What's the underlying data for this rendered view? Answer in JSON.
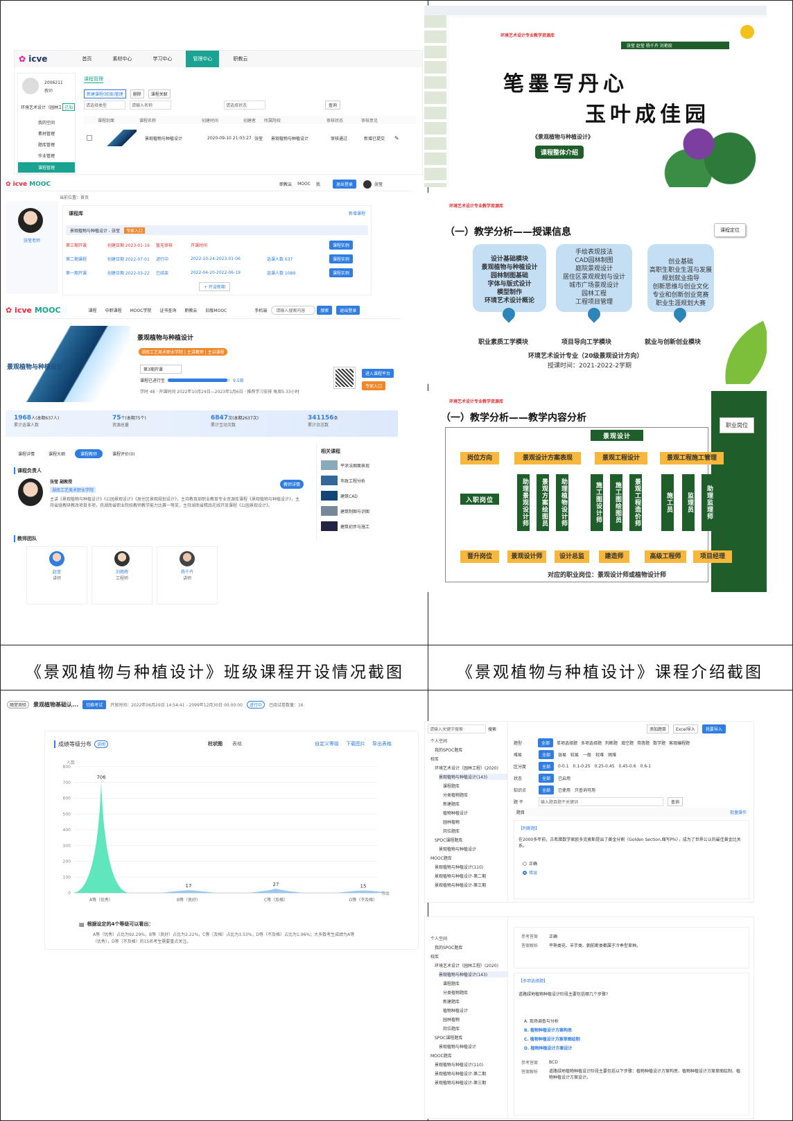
{
  "captions": {
    "left": "《景观植物与种植设计》班级课程开设情况截图",
    "right": "《景观植物与种植设计》课程介绍截图"
  },
  "icve": {
    "logo": "icve",
    "nav": [
      "首页",
      "素材中心",
      "学习中心",
      "管理中心",
      "职教云"
    ],
    "user_id": "2006211",
    "user_role": "教师",
    "school": "环境艺术设计（园林工程）",
    "school_tag": "已加",
    "side": [
      "我的空间",
      "素材管理",
      "题库管理",
      "作业管理",
      "课程管理"
    ],
    "tab": "课程管理",
    "btns": [
      "新建课程(班级)管理",
      "删除",
      "课程关联"
    ],
    "filters": [
      "请选择类型",
      "请输入名称",
      "请选择状态",
      "查询"
    ],
    "cols": [
      "课程封面",
      "课程名称",
      "创建时间",
      "创建者",
      "所属院校",
      "审核状态",
      "审核意见"
    ],
    "row": {
      "name": "景观植物与种植设计",
      "date": "2020-09-10 21:03:27",
      "owner": "张莹",
      "school": "景观植物与种植设计",
      "status": "审核通过",
      "note": "新增已提交"
    }
  },
  "mooc1": {
    "nav": [
      "职教云",
      "MOOC",
      "我"
    ],
    "btn": "退出登录",
    "user": "张莹",
    "crumb": "当前位置：首页",
    "teacher": "张莹老师",
    "lib": "课程库",
    "new": "新增课程",
    "course": "景观植物与种植设计 - 张莹",
    "tag": "专家入口",
    "rows": [
      {
        "t": "第三期开课",
        "d": "创建日期 2023-01-19",
        "s": "暂无审核",
        "p": "开课时间",
        "r": "",
        "a": "课程实例"
      },
      {
        "t": "第二期课程",
        "d": "创建日期 2022-07-01",
        "s": "进行中",
        "p": "2022-10-24-2023-01-06",
        "r": "选课人数 637",
        "a": "课程实例"
      },
      {
        "t": "第一期开课",
        "d": "创建日期 2022-03-22",
        "s": "已结束",
        "p": "2022-04-20-2022-06-19",
        "r": "选课人数 1089",
        "a": "课程实例"
      }
    ],
    "more": "+ 开设新期"
  },
  "mooc2": {
    "nav": [
      "课程",
      "中职课程",
      "MOOC学院",
      "证书查询",
      "职教云",
      "旧版MOOC"
    ],
    "phone": "手机端",
    "search_ph": "请输入搜索内容",
    "search": "搜索",
    "login": "退出登录",
    "title": "景观植物与种植设计",
    "cover": "景观植物与种植设计",
    "badge": "湖南工艺美术职业学院 | 主讲教师 | 主讲课程",
    "term": "第3期开课",
    "progress_label": "课程已进行至",
    "progress": "9.5周",
    "progress_pct": 0.95,
    "meta": "学时 48 · 开课时间 2022年10月24日—2023年1月6日 · 推荐学习安排 每周5.33小时",
    "enter": "进入课程平台",
    "expert": "专家入口",
    "stats": [
      {
        "v": "1968",
        "u": "人",
        "s": "(本期637人)",
        "l": "累计选课人数"
      },
      {
        "v": "75",
        "u": "个",
        "s": "(本期75个)",
        "l": "资源总量"
      },
      {
        "v": "6847",
        "u": "次",
        "s": "(本期2637次)",
        "l": "累计互动次数"
      },
      {
        "v": "341156",
        "u": "条",
        "s": "",
        "l": "累计日志数"
      }
    ],
    "tabs": [
      "课程详情",
      "课程大纲",
      "课程教师",
      "课程评价(0)"
    ],
    "lead": "课程负责人",
    "lead_name": "张莹 副教授",
    "lead_sub": "湖南工艺美术职业学院",
    "lead_btn": "教师详情",
    "lead_text": "主讲《景观植物与种植设计》《公园景观设计》《居住区景观规划设计》，主持教育部职业教育专业资源库课程《景观植物与种植设计》，主持省级教研教改项目多项，获湖南省职业院校教师教学能力比赛一等奖，主持湖南省精品在线开放课程《公园景观设计》。",
    "team": "教师团队",
    "members": [
      {
        "n": "赵莹",
        "r": "讲师"
      },
      {
        "n": "刘艳辉",
        "r": "工程师"
      },
      {
        "n": "杨千卉",
        "r": "讲师"
      }
    ],
    "related": "相关课程",
    "rel": [
      "平涂法图面表现",
      "市政工程分析",
      "建筑CAD",
      "建筑制图与识图",
      "建筑初步与施工"
    ]
  },
  "slide1": {
    "brand": "环境艺术设计专业教学资源库",
    "authors": "张莹  赵莹  杨千卉  刘艳玫",
    "line1": "笔墨写丹心",
    "line2": "玉叶成佳园",
    "course": "《景观植物与种植设计》",
    "pill": "课程整体介绍"
  },
  "slide2": {
    "brand": "环境艺术设计专业教学资源库",
    "title": "（一）教学分析——授课信息",
    "tag": "课程定位",
    "c1": [
      "设计基础模块",
      "景观植物与种植设计",
      "园林制图基础",
      "字体与版式设计",
      "模型制作",
      "环境艺术设计概论"
    ],
    "c2": [
      "手绘表现技法",
      "CAD园林制图",
      "庭院景观设计",
      "居住区景观规划与设计",
      "城市广场景观设计",
      "园林工程",
      "工程项目管理"
    ],
    "c3": [
      "创业基础",
      "高职生职业生涯与发展规划就业指导",
      "创新思维与创业文化",
      "专业和创新创业竞赛",
      "职业生涯规划大赛"
    ],
    "labels": [
      "职业素质工学模块",
      "项目导向工学模块",
      "就业与创新创业模块"
    ],
    "major": "环境艺术设计专业（20级景观设计方向）",
    "time": "授课时间：2021-2022-2学期"
  },
  "slide3": {
    "brand": "环境艺术设计专业教学资源库",
    "title": "（一）教学分析——教学内容分析",
    "tag": "职业岗位",
    "top": "景观设计",
    "dir": "岗位方向",
    "entry": "入职岗位",
    "up": "晋升岗位",
    "cats": [
      "景观设计方案表现",
      "景观工程设计",
      "景观工程施工管理"
    ],
    "v": [
      "助理景观设计师",
      "景观方案绘图员",
      "助理植物设计师",
      "施工图设计师",
      "施工图绘图员",
      "景观工程造价师",
      "施工员",
      "监理员",
      "助理监理师"
    ],
    "promo": [
      "景观设计师",
      "设计总监",
      "建造师",
      "高级工程师",
      "项目经理"
    ],
    "foot": "对应的职业岗位：景观设计师或植物设计师"
  },
  "chart_header": {
    "tag": "随堂测验",
    "title": "景观植物基础认...",
    "btn": "切换考试",
    "time": "开放时间：2022年06月29日 14:54:41 - 2099年12月30日 00:00:00",
    "state": "进行中",
    "count": "已阅试卷数量：16"
  },
  "chart_data": {
    "type": "area",
    "title": "成绩等级分布",
    "title_tag": "说明",
    "ylabel": "人数",
    "xlabel": "等级",
    "categories": [
      "A等（优秀）",
      "B等（良好）",
      "C等（及格）",
      "D等（不及格）"
    ],
    "values": [
      706,
      17,
      27,
      15
    ],
    "ylim": [
      0,
      800
    ],
    "yticks": [
      0,
      100,
      200,
      300,
      400,
      500,
      600,
      700,
      800
    ],
    "tools": [
      "柱状图",
      "表格",
      "自定义等级",
      "下载图片",
      "导出表格"
    ]
  },
  "chart_note": {
    "head": "根据设定的4个等级可以看出：",
    "text": "A等（优秀）占比为92.29%，B等（良好）占比为2.22%，C等（及格）占比为3.53%，D等（不及格）占比为1.96%；大多数考生成绩为A等（优秀），D等（不及格）的15名考生需要重点关注。"
  },
  "bank": {
    "search_ph": "请输入关键字搜索",
    "search": "搜索",
    "tree": [
      "个人空间",
      "我的SPOC题库",
      "校库",
      "环境艺术设计（园林工程）(2020)",
      "景观植物与种植设计(143)",
      "课程题库",
      "分类植物题库",
      "新建题库",
      "植物种植设计",
      "园林植物",
      "岗位题库",
      "SPOC课程题库",
      "景观植物与种植设计",
      "MOOC题库",
      "景观植物与种植设计(110)",
      "景观植物与种植设计-第二期",
      "景观植物与种植设计-第三期"
    ],
    "tools": [
      "添加题目",
      "Excel导入",
      "我要导入"
    ],
    "filters": [
      [
        "题型",
        "全部",
        "单项选择题",
        "多项选择题",
        "判断题",
        "填空题",
        "简答题",
        "数学题",
        "客观编程题"
      ],
      [
        "难易",
        "全部",
        "容易",
        "较易",
        "一般",
        "较难",
        "困难"
      ],
      [
        "区分度",
        "全部",
        "0-0.1",
        "0.1-0.25",
        "0.25-0.45",
        "0.45-0.6",
        "0.6-1"
      ],
      [
        "状态",
        "全部",
        "已启用"
      ],
      [
        "知识点",
        "全部",
        "已使用",
        "只查询可用"
      ]
    ],
    "kw": "题  干",
    "kw_ph": "输入题目题干关键词",
    "kw_btn": "查询",
    "list": "题目",
    "batch": "批量操作",
    "q1_tag": "【判断题】",
    "q1": "在2000多年前，古希腊数学家欧多克索斯提出了黄金分割（Golden Section,缩写Phi），成为了世界公认的最佳黄金比关系。",
    "q1_opts": [
      "正确",
      "错误"
    ],
    "a_label": "参考答案",
    "a_val": "正确",
    "p_label": "答案解析",
    "p_val": "平熟类花、羊芋类、朝前断类都属于冷季型草种。",
    "q2_tag": "【多项选择题】",
    "q2": "道路绿地植物种植设计阶段主要包括哪几个步骤?",
    "q2_opts": [
      "A. 现场调查与分析",
      "B. 植物种植设计方案构思",
      "C. 植物种植设计方案草图绘制",
      "D. 植物种植设计方案设计"
    ],
    "a2_val": "BCD",
    "p2_val": "道路绿地植物种植设计阶段主要包括以下步骤：植物种植设计方案构思、植物种植设计方案草图绘制、植物种植设计方案设计。"
  },
  "colors": {
    "blue": "#2f7de1",
    "teal": "#1aa390",
    "orange": "#f0882a",
    "green": "#1f5e2a",
    "mint": "#4fe3b6",
    "slide_purple": "#7b3fa0"
  }
}
